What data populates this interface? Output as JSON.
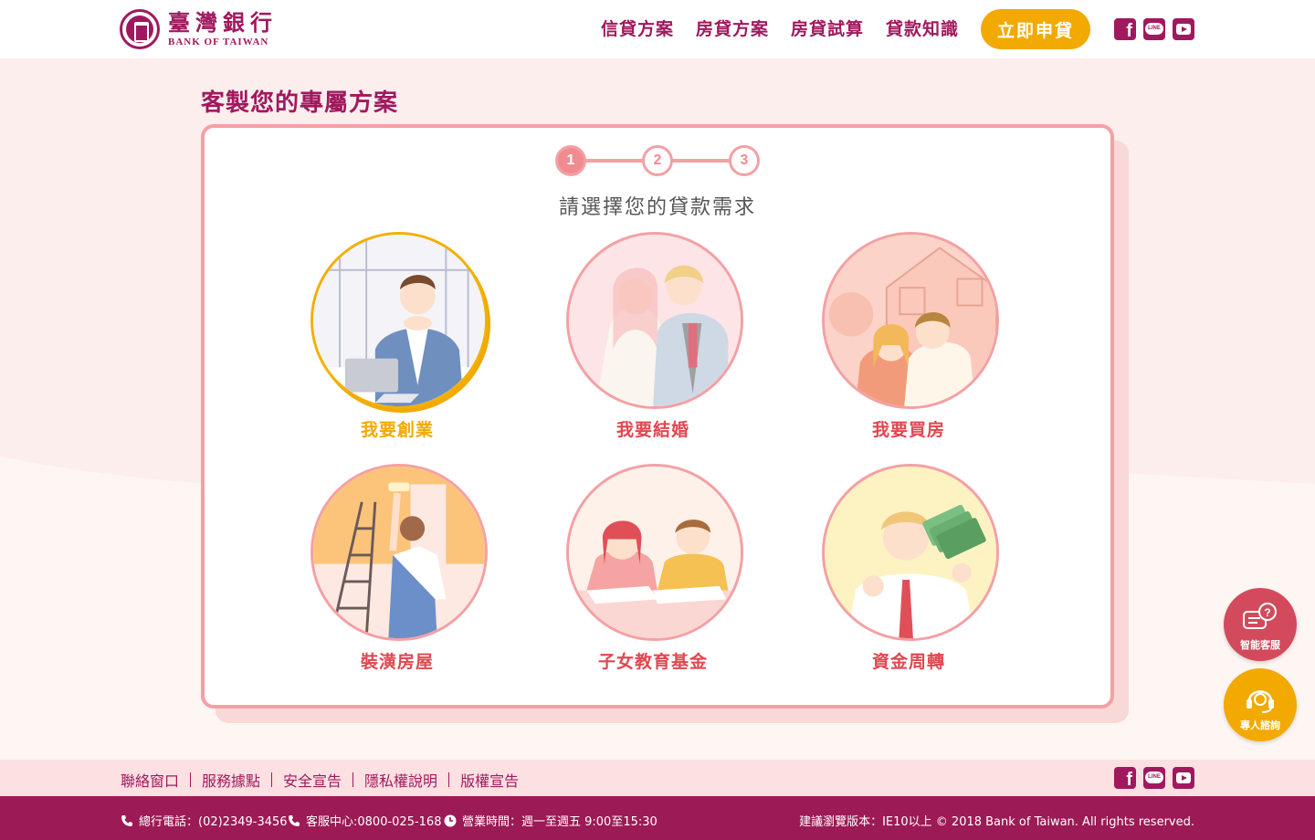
{
  "header": {
    "logo_cn": "臺灣銀行",
    "logo_en": "BANK OF TAIWAN",
    "nav": [
      "信貸方案",
      "房貸方案",
      "房貸試算",
      "貸款知識"
    ],
    "apply_label": "立即申貸",
    "social": [
      "facebook-icon",
      "line-icon",
      "youtube-icon"
    ]
  },
  "page": {
    "title": "客製您的專屬方案",
    "subtitle": "請選擇您的貸款需求",
    "steps": [
      "1",
      "2",
      "3"
    ],
    "active_step": 1
  },
  "options": [
    {
      "label": "我要創業",
      "selected": true
    },
    {
      "label": "我要結婚",
      "selected": false
    },
    {
      "label": "我要買房",
      "selected": false
    },
    {
      "label": "裝潢房屋",
      "selected": false
    },
    {
      "label": "子女教育基金",
      "selected": false
    },
    {
      "label": "資金周轉",
      "selected": false
    }
  ],
  "floating": {
    "ai_label": "智能客服",
    "expert_label": "專人諮詢"
  },
  "footer": {
    "links": [
      "聯絡窗口",
      "服務據點",
      "安全宣告",
      "隱私權說明",
      "版權宣告"
    ],
    "phone": "總行電話：(02)2349-3456",
    "service": "客服中心:0800-025-168",
    "hours": "營業時間：週一至週五 9:00至15:30",
    "copyright": "建議瀏覽版本：IE10以上 © 2018 Bank of Taiwan. All rights reserved."
  },
  "colors": {
    "brand": "#a0195e",
    "accent": "#f2a900",
    "pink": "#f4a0a4",
    "label": "#e0474f"
  }
}
